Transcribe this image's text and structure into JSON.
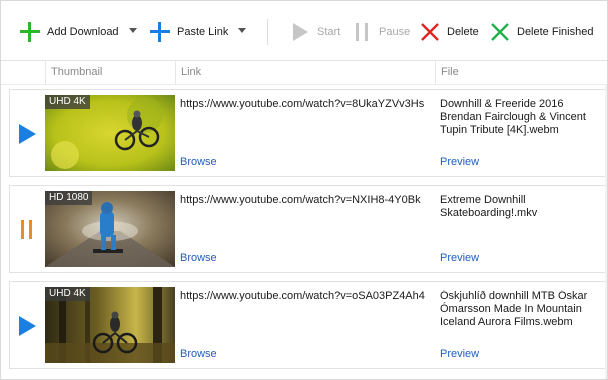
{
  "toolbar": {
    "add_download": "Add Download",
    "paste_link": "Paste Link",
    "start": "Start",
    "pause": "Pause",
    "delete": "Delete",
    "delete_finished": "Delete Finished"
  },
  "columns": {
    "thumbnail": "Thumbnail",
    "link": "Link",
    "file": "File"
  },
  "rows": [
    {
      "status": "play-icon",
      "badge": "UHD 4K",
      "link": "https://www.youtube.com/watch?v=8UkaYZVv3Hs",
      "browse": "Browse",
      "file": "Downhill & Freeride 2016  Brendan Fairclough & Vincent Tupin Tribute [4K].webm",
      "preview": "Preview"
    },
    {
      "status": "pause-icon",
      "badge": "HD 1080",
      "link": "https://www.youtube.com/watch?v=NXIH8-4Y0Bk",
      "browse": "Browse",
      "file": "Extreme Downhill Skateboarding!.mkv",
      "preview": "Preview"
    },
    {
      "status": "play-icon",
      "badge": "UHD 4K",
      "link": "https://www.youtube.com/watch?v=oSA03PZ4Ah4",
      "browse": "Browse",
      "file": "Óskjuhlíð downhill MTB Óskar Ómarsson Made In Mountain  Iceland Aurora Films.webm",
      "preview": "Preview"
    }
  ],
  "colors": {
    "add_icon": "#2db52d",
    "paste_icon": "#1a7fe0",
    "delete_icon": "#e02424",
    "delete_finished_icon": "#22b14c",
    "play": "#1a7fe0",
    "pause": "#f08a24",
    "link": "#1f5fbf"
  }
}
